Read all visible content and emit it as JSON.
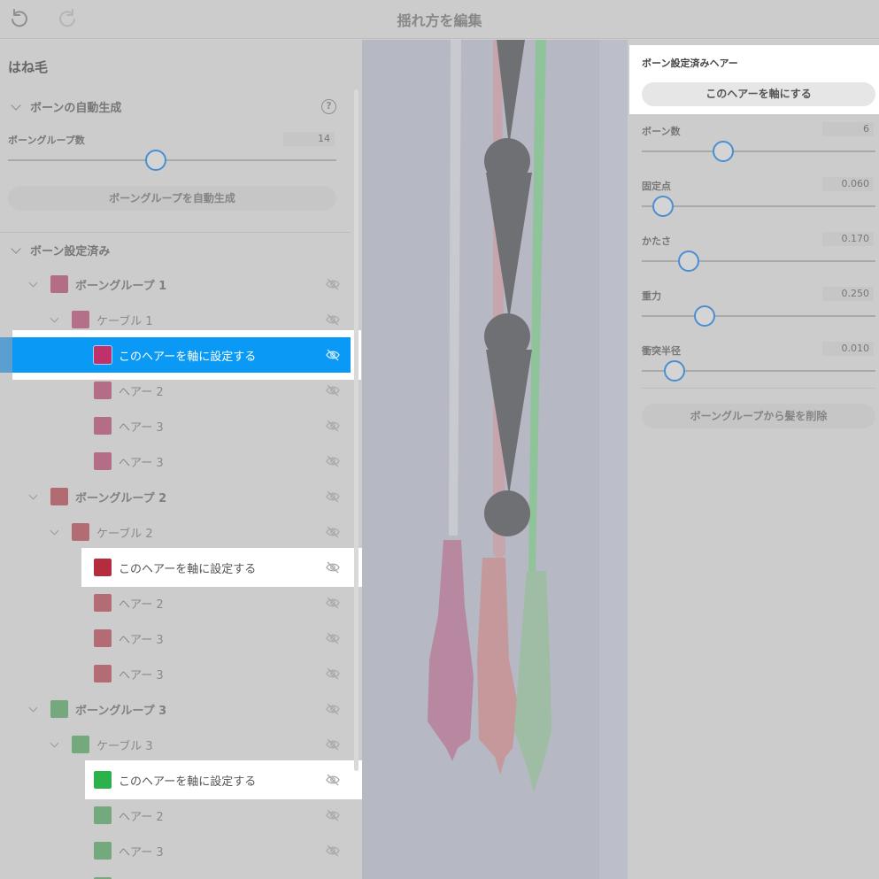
{
  "header": {
    "title": "揺れ方を編集",
    "undo_icon": "undo-icon",
    "redo_icon": "redo-icon"
  },
  "left_panel": {
    "title": "はね毛",
    "auto_section": {
      "label": "ボーンの自動生成",
      "help_glyph": "?",
      "bone_group_count_label": "ボーングループ数",
      "bone_group_count_value": "14",
      "bone_group_count_level": 0.45,
      "generate_button": "ボーングループを自動生成"
    },
    "configured_section": {
      "label": "ボーン設定済み"
    },
    "tree": [
      {
        "kind": "group",
        "label": "ボーングループ 1",
        "color": "#b46d87"
      },
      {
        "kind": "cable",
        "label": "ケーブル 1",
        "color": "#b47088"
      },
      {
        "kind": "hair",
        "label": "このヘアーを軸に設定する",
        "color": "#c0306a",
        "highlight": "blue"
      },
      {
        "kind": "hair",
        "label": "ヘアー 2",
        "color": "#b36d86"
      },
      {
        "kind": "hair",
        "label": "ヘアー 3",
        "color": "#b36d86"
      },
      {
        "kind": "hair",
        "label": "ヘアー 3",
        "color": "#b36d86"
      },
      {
        "kind": "group",
        "label": "ボーングループ 2",
        "color": "#b36b72"
      },
      {
        "kind": "cable",
        "label": "ケーブル 2",
        "color": "#b36c73"
      },
      {
        "kind": "hair",
        "label": "このヘアーを軸に設定する",
        "color": "#b52c3e",
        "highlight": "white"
      },
      {
        "kind": "hair",
        "label": "ヘアー 2",
        "color": "#b36c73"
      },
      {
        "kind": "hair",
        "label": "ヘアー 3",
        "color": "#b36c73"
      },
      {
        "kind": "hair",
        "label": "ヘアー 3",
        "color": "#b36c73"
      },
      {
        "kind": "group",
        "label": "ボーングループ 3",
        "color": "#74a97e"
      },
      {
        "kind": "cable",
        "label": "ケーブル 3",
        "color": "#74a97e"
      },
      {
        "kind": "hair",
        "label": "このヘアーを軸に設定する",
        "color": "#2bb24a",
        "highlight": "white"
      },
      {
        "kind": "hair",
        "label": "ヘアー 2",
        "color": "#74a97e"
      },
      {
        "kind": "hair",
        "label": "ヘアー 3",
        "color": "#74a97e"
      },
      {
        "kind": "hair",
        "label": "",
        "color": "#74a97e"
      }
    ]
  },
  "right_panel": {
    "title": "ボーン設定済みヘアー",
    "axis_button": "このヘアーを軸にする",
    "params": [
      {
        "label": "ボーン数",
        "value": "6",
        "level": 0.35
      },
      {
        "label": "固定点",
        "value": "0.060",
        "level": 0.09
      },
      {
        "label": "かたさ",
        "value": "0.170",
        "level": 0.2
      },
      {
        "label": "重力",
        "value": "0.250",
        "level": 0.27
      },
      {
        "label": "衝突半径",
        "value": "0.010",
        "level": 0.14
      }
    ],
    "remove_button": "ボーングループから髪を削除"
  },
  "colors": {
    "accent_blue": "#0a9af5",
    "slider_knob_border": "#4a8fd2",
    "bone_gray": "#6f7074"
  }
}
